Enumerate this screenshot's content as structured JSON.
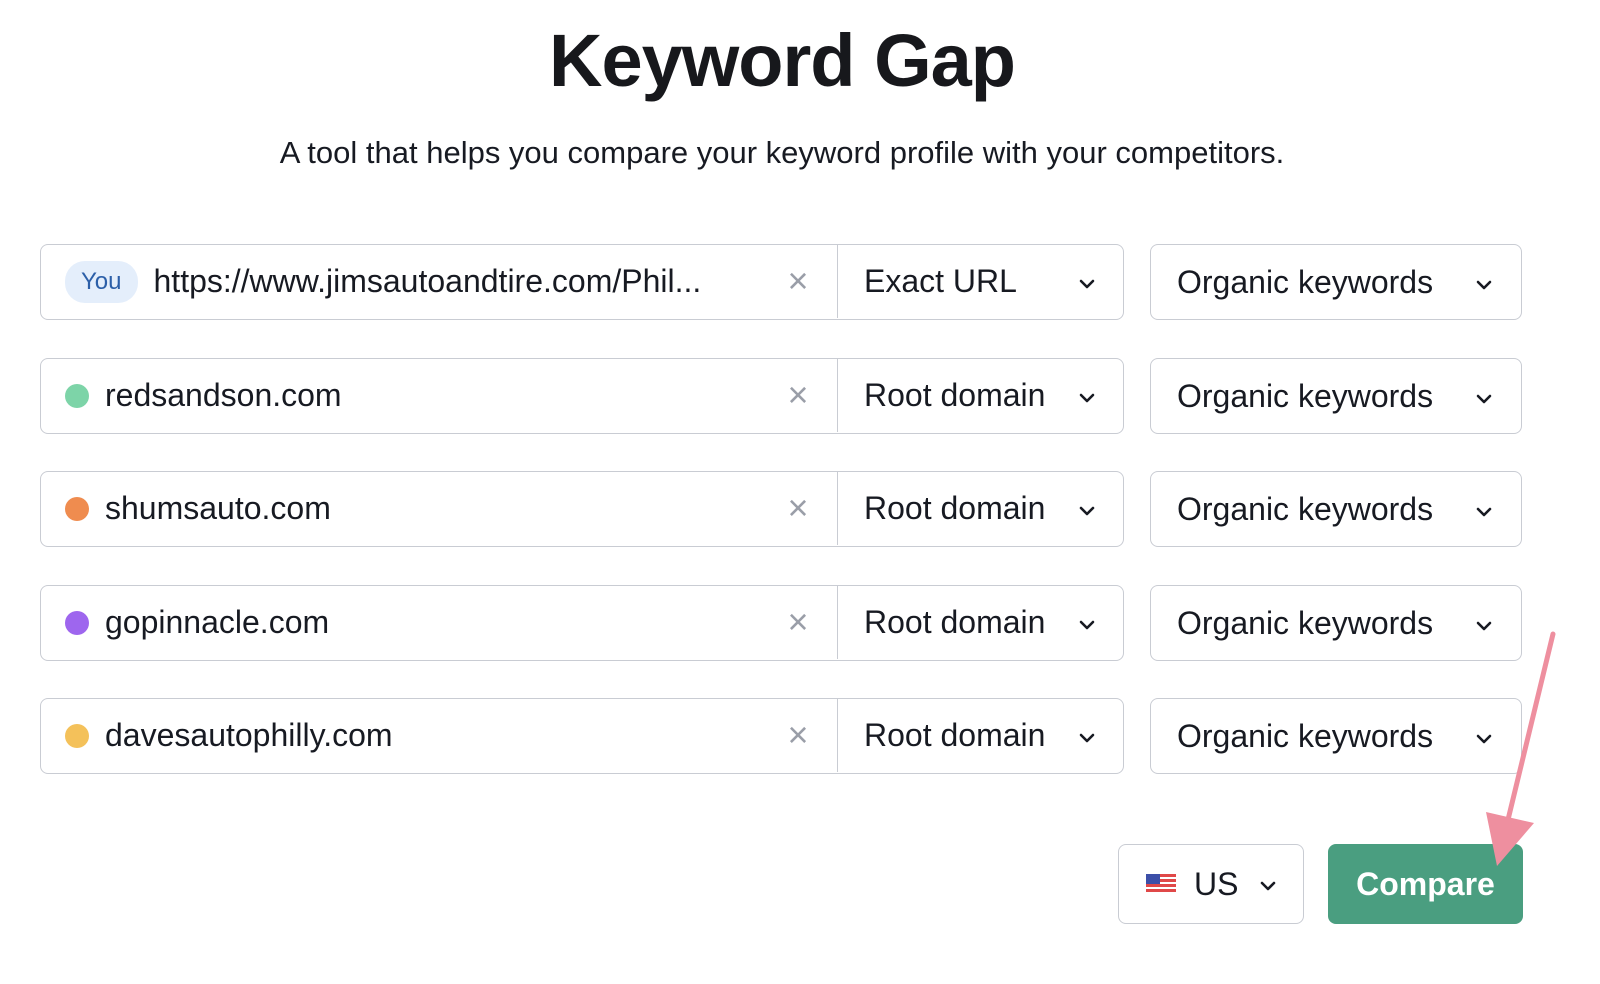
{
  "header": {
    "title": "Keyword Gap",
    "subtitle": "A tool that helps you compare your keyword profile with your competitors."
  },
  "rows": [
    {
      "badge": "You",
      "dot_color": null,
      "domain": "https://www.jimsautoandtire.com/Phil...",
      "scope": "Exact URL",
      "keyword_type": "Organic keywords"
    },
    {
      "badge": null,
      "dot_color": "#7dd4a8",
      "domain": "redsandson.com",
      "scope": "Root domain",
      "keyword_type": "Organic keywords"
    },
    {
      "badge": null,
      "dot_color": "#ef8c4f",
      "domain": "shumsauto.com",
      "scope": "Root domain",
      "keyword_type": "Organic keywords"
    },
    {
      "badge": null,
      "dot_color": "#9e66ee",
      "domain": "gopinnacle.com",
      "scope": "Root domain",
      "keyword_type": "Organic keywords"
    },
    {
      "badge": null,
      "dot_color": "#f4c15a",
      "domain": "davesautophilly.com",
      "scope": "Root domain",
      "keyword_type": "Organic keywords"
    }
  ],
  "footer": {
    "country_icon": "us-flag-icon",
    "country": "US",
    "compare_label": "Compare",
    "compare_color": "#4a9e80",
    "annotation_arrow_color": "#ee8f9f"
  }
}
